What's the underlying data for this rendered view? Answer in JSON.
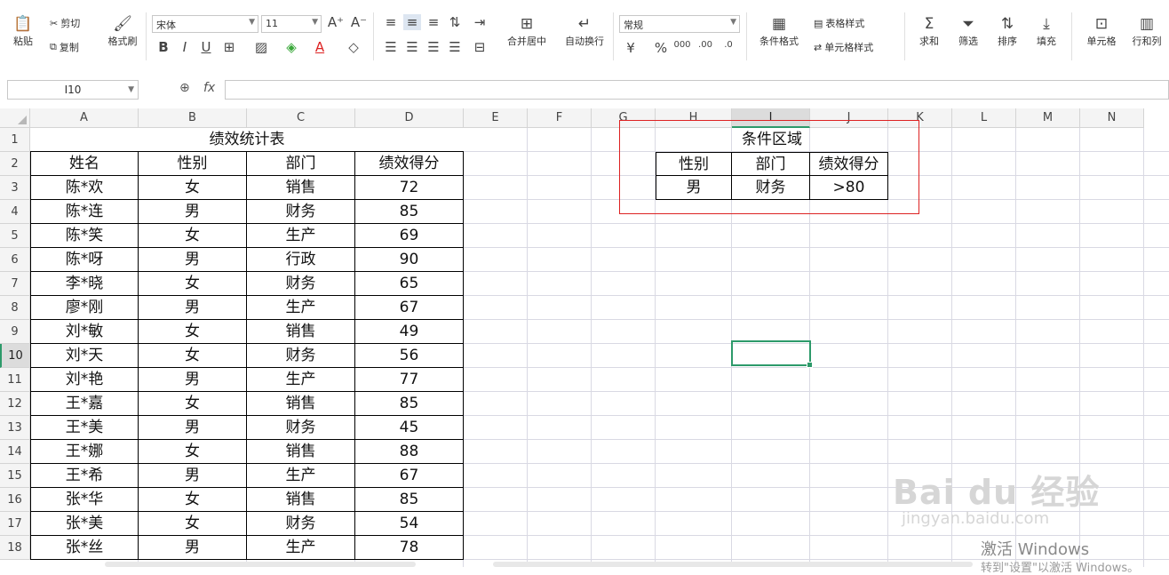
{
  "ribbon": {
    "paste": "粘贴",
    "cut": "剪切",
    "copy": "复制",
    "format_painter": "格式刷",
    "font_name": "宋体",
    "font_size": "11",
    "merge_center": "合并居中",
    "wrap_text": "自动换行",
    "number_format": "常规",
    "conditional_format": "条件格式",
    "table_style": "表格样式",
    "cell_style": "单元格样式",
    "sum": "求和",
    "filter": "筛选",
    "sort": "排序",
    "fill": "填充",
    "cells": "单元格",
    "rows_cols": "行和列",
    "currency_symbol": "¥",
    "percent_symbol": "%",
    "thousands": "000",
    "inc_decimal": ".00",
    "dec_decimal": ".0"
  },
  "formula_bar": {
    "cell_ref": "I10",
    "fx": "fx",
    "value": ""
  },
  "columns": [
    "A",
    "B",
    "C",
    "D",
    "E",
    "F",
    "G",
    "H",
    "I",
    "J",
    "K",
    "L",
    "M",
    "N"
  ],
  "selected_column": "I",
  "selected_row": "10",
  "rows": [
    "1",
    "2",
    "3",
    "4",
    "5",
    "6",
    "7",
    "8",
    "9",
    "10",
    "11",
    "12",
    "13",
    "14",
    "15",
    "16",
    "17",
    "18"
  ],
  "table": {
    "title": "绩效统计表",
    "headers": [
      "姓名",
      "性别",
      "部门",
      "绩效得分"
    ],
    "records": [
      [
        "陈*欢",
        "女",
        "销售",
        "72"
      ],
      [
        "陈*连",
        "男",
        "财务",
        "85"
      ],
      [
        "陈*笑",
        "女",
        "生产",
        "69"
      ],
      [
        "陈*呀",
        "男",
        "行政",
        "90"
      ],
      [
        "李*晓",
        "女",
        "财务",
        "65"
      ],
      [
        "廖*刚",
        "男",
        "生产",
        "67"
      ],
      [
        "刘*敏",
        "女",
        "销售",
        "49"
      ],
      [
        "刘*天",
        "女",
        "财务",
        "56"
      ],
      [
        "刘*艳",
        "男",
        "生产",
        "77"
      ],
      [
        "王*嘉",
        "女",
        "销售",
        "85"
      ],
      [
        "王*美",
        "男",
        "财务",
        "45"
      ],
      [
        "王*娜",
        "女",
        "销售",
        "88"
      ],
      [
        "王*希",
        "男",
        "生产",
        "67"
      ],
      [
        "张*华",
        "女",
        "销售",
        "85"
      ],
      [
        "张*美",
        "女",
        "财务",
        "54"
      ],
      [
        "张*丝",
        "男",
        "生产",
        "78"
      ]
    ]
  },
  "criteria": {
    "title": "条件区域",
    "headers": [
      "性别",
      "部门",
      "绩效得分"
    ],
    "values": [
      "男",
      "财务",
      ">80"
    ]
  },
  "watermark": {
    "brand": "Bai du 经验",
    "url": "jingyan.baidu.com"
  },
  "activation": {
    "line1": "激活 Windows",
    "line2": "转到\"设置\"以激活 Windows。"
  },
  "colors": {
    "accent_green": "#2d9a6a",
    "highlight_red": "#dd2222"
  }
}
